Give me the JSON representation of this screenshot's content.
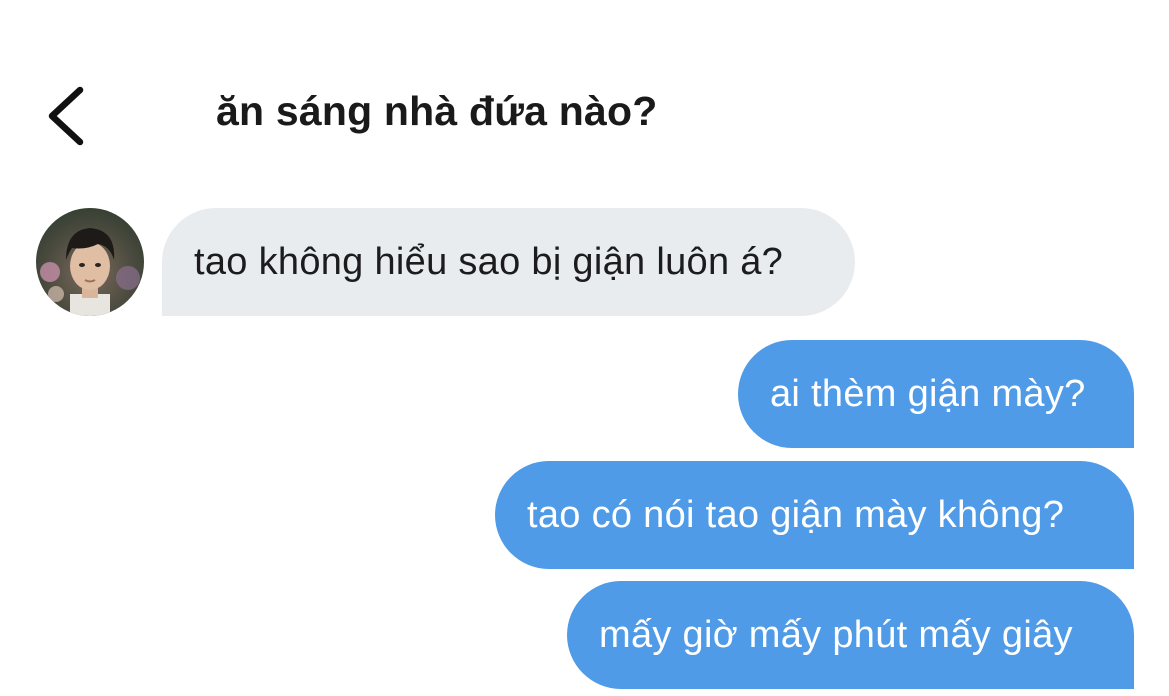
{
  "header": {
    "back_icon": "chevron-left-icon",
    "title": "ăn sáng nhà đứa nào?"
  },
  "messages": [
    {
      "sender": "other",
      "text": "tao không hiểu sao bị giận luôn á?"
    },
    {
      "sender": "me",
      "text": "ai thèm giận mày?"
    },
    {
      "sender": "me",
      "text": "tao có nói tao giận mày không?"
    },
    {
      "sender": "me",
      "text": "mấy giờ mấy phút mấy giây"
    }
  ],
  "colors": {
    "incoming_bubble": "#e9ecef",
    "outgoing_bubble": "#4f9be8",
    "outgoing_text": "#ffffff",
    "title_text": "#1a1a1a"
  }
}
